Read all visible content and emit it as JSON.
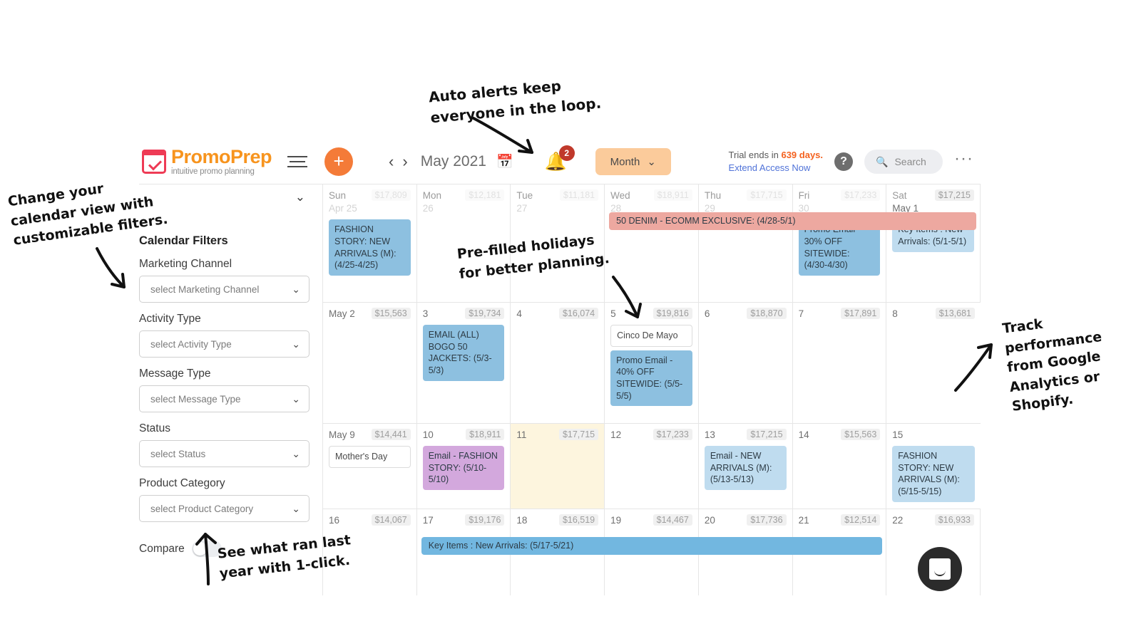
{
  "brand": {
    "name": "PromoPrep",
    "tagline": "intuitive promo planning",
    "logo_icon": "calendar-check-icon",
    "accent_orange": "#f7941e",
    "accent_red": "#ee3b55"
  },
  "header": {
    "menu_icon": "hamburger-icon",
    "add_label": "+",
    "prev_label": "‹",
    "next_label": "›",
    "month_label": "May 2021",
    "calendar_icon": "calendar-icon",
    "bell_icon": "bell-icon",
    "notification_count": "2",
    "view_select": "Month",
    "view_caret": "⌄",
    "trial_prefix": "Trial ends in ",
    "trial_days": "639 days.",
    "extend_link": "Extend Access Now",
    "help_icon": "question-mark-icon",
    "help_label": "?",
    "search_icon": "search-icon",
    "search_placeholder": "Search",
    "more_label": "···"
  },
  "sidebar": {
    "collapse_icon": "chevron-down-icon",
    "title": "Calendar Filters",
    "filters": [
      {
        "label": "Marketing Channel",
        "value": "select Marketing Channel"
      },
      {
        "label": "Activity Type",
        "value": "select Activity Type"
      },
      {
        "label": "Message Type",
        "value": "select Message Type"
      },
      {
        "label": "Status",
        "value": "select Status"
      },
      {
        "label": "Product Category",
        "value": "select Product Category"
      }
    ],
    "compare_label": "Compare",
    "compare_on": false
  },
  "calendar": {
    "weeks": [
      {
        "days": [
          {
            "dow": "Sun",
            "num": "Apr 25",
            "revenue": "$17,809",
            "faded": true,
            "today": false,
            "events": [
              {
                "text": "FASHION STORY: NEW ARRIVALS (M): (4/25-4/25)",
                "color": "blue"
              }
            ]
          },
          {
            "dow": "Mon",
            "num": "26",
            "revenue": "$12,181",
            "faded": true,
            "today": false,
            "events": []
          },
          {
            "dow": "Tue",
            "num": "27",
            "revenue": "$11,181",
            "faded": true,
            "today": false,
            "events": []
          },
          {
            "dow": "Wed",
            "num": "28",
            "revenue": "$18,911",
            "faded": true,
            "today": false,
            "events": []
          },
          {
            "dow": "Thu",
            "num": "29",
            "revenue": "$17,715",
            "faded": true,
            "today": false,
            "events": []
          },
          {
            "dow": "Fri",
            "num": "30",
            "revenue": "$17,233",
            "faded": true,
            "today": false,
            "events": [
              {
                "text": "Promo Email - 30% OFF SITEWIDE: (4/30-4/30)",
                "color": "blue"
              }
            ]
          },
          {
            "dow": "Sat",
            "num": "May 1",
            "revenue": "$17,215",
            "faded": false,
            "today": false,
            "events": [
              {
                "text": "Key Items : New Arrivals: (5/1-5/1)",
                "color": "bluelight"
              }
            ]
          }
        ],
        "spans": [
          {
            "text": "50 DENIM - ECOMM EXCLUSIVE: (4/28-5/1)",
            "color": "span-red",
            "start": 3,
            "end": 6
          }
        ]
      },
      {
        "days": [
          {
            "dow": "",
            "num": "May 2",
            "revenue": "$15,563",
            "faded": false,
            "today": false,
            "events": []
          },
          {
            "dow": "",
            "num": "3",
            "revenue": "$19,734",
            "faded": false,
            "today": false,
            "events": [
              {
                "text": "EMAIL (ALL) BOGO 50 JACKETS: (5/3-5/3)",
                "color": "blue"
              }
            ]
          },
          {
            "dow": "",
            "num": "4",
            "revenue": "$16,074",
            "faded": false,
            "today": false,
            "events": []
          },
          {
            "dow": "",
            "num": "5",
            "revenue": "$19,816",
            "faded": false,
            "today": false,
            "events": [
              {
                "text": "Cinco De Mayo",
                "color": "white"
              },
              {
                "text": "Promo Email - 40% OFF SITEWIDE: (5/5-5/5)",
                "color": "blue"
              }
            ]
          },
          {
            "dow": "",
            "num": "6",
            "revenue": "$18,870",
            "faded": false,
            "today": false,
            "events": []
          },
          {
            "dow": "",
            "num": "7",
            "revenue": "$17,891",
            "faded": false,
            "today": false,
            "events": []
          },
          {
            "dow": "",
            "num": "8",
            "revenue": "$13,681",
            "faded": false,
            "today": false,
            "events": []
          }
        ],
        "spans": []
      },
      {
        "days": [
          {
            "dow": "",
            "num": "May 9",
            "revenue": "$14,441",
            "faded": false,
            "today": false,
            "events": [
              {
                "text": "Mother's Day",
                "color": "white"
              }
            ]
          },
          {
            "dow": "",
            "num": "10",
            "revenue": "$18,911",
            "faded": false,
            "today": false,
            "events": [
              {
                "text": "Email - FASHION STORY: (5/10-5/10)",
                "color": "purple"
              }
            ]
          },
          {
            "dow": "",
            "num": "11",
            "revenue": "$17,715",
            "faded": false,
            "today": true,
            "events": []
          },
          {
            "dow": "",
            "num": "12",
            "revenue": "$17,233",
            "faded": false,
            "today": false,
            "events": []
          },
          {
            "dow": "",
            "num": "13",
            "revenue": "$17,215",
            "faded": false,
            "today": false,
            "events": [
              {
                "text": "Email - NEW ARRIVALS (M): (5/13-5/13)",
                "color": "bluelight"
              }
            ]
          },
          {
            "dow": "",
            "num": "14",
            "revenue": "$15,563",
            "faded": false,
            "today": false,
            "events": []
          },
          {
            "dow": "",
            "num": "15",
            "revenue": "",
            "faded": false,
            "today": false,
            "events": [
              {
                "text": "FASHION STORY: NEW ARRIVALS (M): (5/15-5/15)",
                "color": "bluelight"
              }
            ]
          }
        ],
        "spans": []
      },
      {
        "days": [
          {
            "dow": "",
            "num": "16",
            "revenue": "$14,067",
            "faded": false,
            "today": false,
            "events": []
          },
          {
            "dow": "",
            "num": "17",
            "revenue": "$19,176",
            "faded": false,
            "today": false,
            "events": []
          },
          {
            "dow": "",
            "num": "18",
            "revenue": "$16,519",
            "faded": false,
            "today": false,
            "events": []
          },
          {
            "dow": "",
            "num": "19",
            "revenue": "$14,467",
            "faded": false,
            "today": false,
            "events": []
          },
          {
            "dow": "",
            "num": "20",
            "revenue": "$17,736",
            "faded": false,
            "today": false,
            "events": []
          },
          {
            "dow": "",
            "num": "21",
            "revenue": "$12,514",
            "faded": false,
            "today": false,
            "events": []
          },
          {
            "dow": "",
            "num": "22",
            "revenue": "$16,933",
            "faded": false,
            "today": false,
            "events": []
          }
        ],
        "spans": [
          {
            "text": "Key Items : New Arrivals: (5/17-5/21)",
            "color": "span-blue",
            "start": 1,
            "end": 5
          }
        ]
      }
    ]
  },
  "chat": {
    "icon": "chat-smiley-icon"
  },
  "annotations": [
    {
      "id": "anno-alerts",
      "text": "Auto alerts keep\neveryone in the loop."
    },
    {
      "id": "anno-filters",
      "text": "Change your\ncalendar view with\ncustomizable filters."
    },
    {
      "id": "anno-holidays",
      "text": "Pre-filled holidays\nfor better planning."
    },
    {
      "id": "anno-track",
      "text": "Track\nperformance\nfrom Google\nAnalytics or\nShopify."
    },
    {
      "id": "anno-compare",
      "text": "See what ran last\nyear with 1-click."
    }
  ]
}
